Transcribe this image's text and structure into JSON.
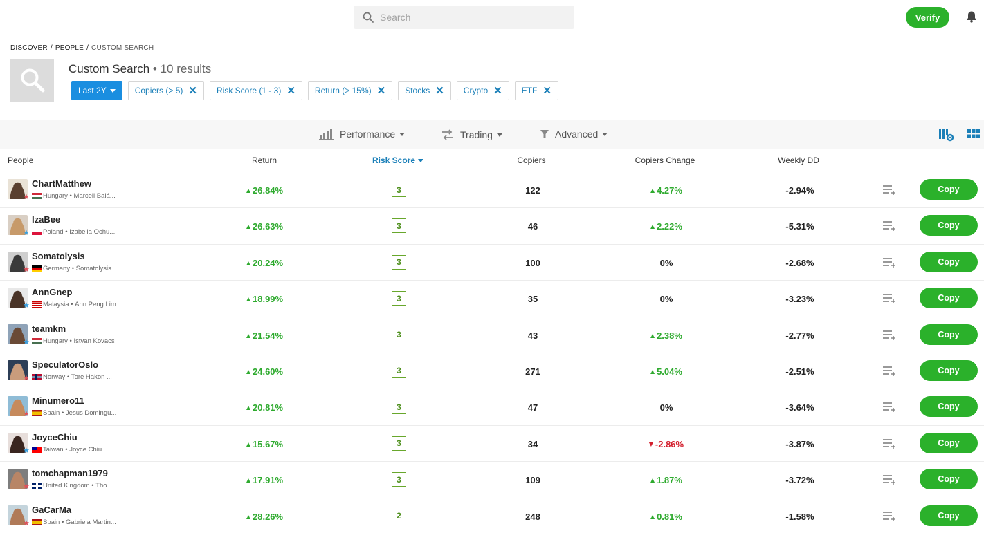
{
  "search": {
    "placeholder": "Search"
  },
  "header": {
    "verify_label": "Verify"
  },
  "breadcrumb": {
    "items": [
      "DISCOVER",
      "PEOPLE",
      "CUSTOM SEARCH"
    ]
  },
  "page": {
    "title": "Custom Search",
    "results": "• 10 results"
  },
  "filters": {
    "period": "Last 2Y",
    "chips": [
      "Copiers (> 5)",
      "Risk Score (1 - 3)",
      "Return (> 15%)",
      "Stocks",
      "Crypto",
      "ETF"
    ]
  },
  "filter_bar": {
    "performance": "Performance",
    "trading": "Trading",
    "advanced": "Advanced"
  },
  "columns": {
    "people": "People",
    "return": "Return",
    "risk": "Risk Score",
    "copiers": "Copiers",
    "copiers_change": "Copiers Change",
    "weekly_dd": "Weekly DD"
  },
  "colors": {
    "accent": "#1a8ee0",
    "positive": "#2eaa2e",
    "negative": "#d3202e",
    "copy": "#2bb12b"
  },
  "rows": [
    {
      "username": "ChartMatthew",
      "country": "Hungary",
      "realname": "Marcell Balá...",
      "star": "red",
      "return": "26.84%",
      "risk": "3",
      "copiers": "122",
      "change": "4.27%",
      "change_dir": "pos",
      "wdd": "-2.94%",
      "copy": "Copy"
    },
    {
      "username": "IzaBee",
      "country": "Poland",
      "realname": "Izabella Ochu...",
      "star": "blue",
      "return": "26.63%",
      "risk": "3",
      "copiers": "46",
      "change": "2.22%",
      "change_dir": "pos",
      "wdd": "-5.31%",
      "copy": "Copy"
    },
    {
      "username": "Somatolysis",
      "country": "Germany",
      "realname": "Somatolysis...",
      "star": "red",
      "return": "20.24%",
      "risk": "3",
      "copiers": "100",
      "change": "0%",
      "change_dir": "zero",
      "wdd": "-2.68%",
      "copy": "Copy"
    },
    {
      "username": "AnnGnep",
      "country": "Malaysia",
      "realname": "Ann Peng Lim",
      "star": "blue",
      "return": "18.99%",
      "risk": "3",
      "copiers": "35",
      "change": "0%",
      "change_dir": "zero",
      "wdd": "-3.23%",
      "copy": "Copy"
    },
    {
      "username": "teamkm",
      "country": "Hungary",
      "realname": "Istvan Kovacs",
      "star": "blue",
      "return": "21.54%",
      "risk": "3",
      "copiers": "43",
      "change": "2.38%",
      "change_dir": "pos",
      "wdd": "-2.77%",
      "copy": "Copy"
    },
    {
      "username": "SpeculatorOslo",
      "country": "Norway",
      "realname": "Tore Hakon ...",
      "star": "red",
      "return": "24.60%",
      "risk": "3",
      "copiers": "271",
      "change": "5.04%",
      "change_dir": "pos",
      "wdd": "-2.51%",
      "copy": "Copy"
    },
    {
      "username": "Minumero11",
      "country": "Spain",
      "realname": "Jesus Domingu...",
      "star": "red",
      "return": "20.81%",
      "risk": "3",
      "copiers": "47",
      "change": "0%",
      "change_dir": "zero",
      "wdd": "-3.64%",
      "copy": "Copy"
    },
    {
      "username": "JoyceChiu",
      "country": "Taiwan",
      "realname": "Joyce Chiu",
      "star": "blue",
      "return": "15.67%",
      "risk": "3",
      "copiers": "34",
      "change": "-2.86%",
      "change_dir": "neg",
      "wdd": "-3.87%",
      "copy": "Copy"
    },
    {
      "username": "tomchapman1979",
      "country": "United Kingdom",
      "realname": "Tho...",
      "star": "red",
      "return": "17.91%",
      "risk": "3",
      "copiers": "109",
      "change": "1.87%",
      "change_dir": "pos",
      "wdd": "-3.72%",
      "copy": "Copy"
    },
    {
      "username": "GaCarMa",
      "country": "Spain",
      "realname": "Gabriela Martin...",
      "star": "red",
      "return": "28.26%",
      "risk": "2",
      "copiers": "248",
      "change": "0.81%",
      "change_dir": "pos",
      "wdd": "-1.58%",
      "copy": "Copy"
    }
  ]
}
